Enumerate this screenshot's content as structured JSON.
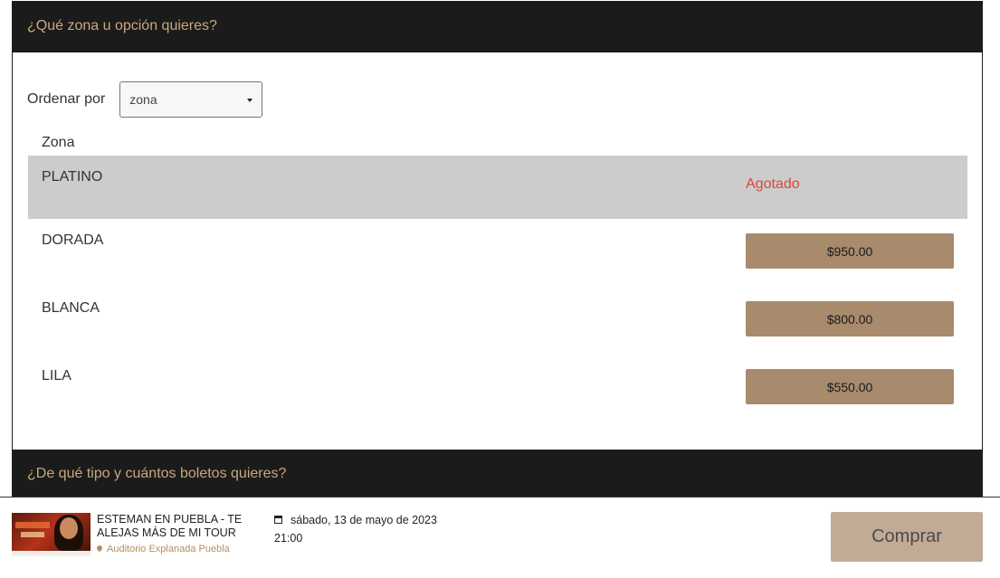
{
  "zone_section": {
    "title": "¿Qué zona u opción quieres?",
    "sort_label": "Ordenar por",
    "sort_selected": "zona",
    "column_header": "Zona",
    "zones": [
      {
        "name": "PLATINO",
        "status": "Agotado",
        "price": null
      },
      {
        "name": "DORADA",
        "status": null,
        "price": "$950.00"
      },
      {
        "name": "BLANCA",
        "status": null,
        "price": "$800.00"
      },
      {
        "name": "LILA",
        "status": null,
        "price": "$550.00"
      }
    ]
  },
  "tickets_section": {
    "title": "¿De qué tipo y cuántos boletos quieres?"
  },
  "event": {
    "title": "ESTEMAN EN PUEBLA - TE ALEJAS MÁS DE MI TOUR",
    "venue": "Auditorio Explanada Puebla",
    "date": "sábado, 13 de mayo de 2023",
    "time": "21:00",
    "buy_label": "Comprar"
  },
  "colors": {
    "header_bg": "#1b1b1b",
    "header_text": "#c9a77f",
    "price_button": "#a88a6c",
    "soldout_text": "#e0453a",
    "buy_button": "#c1ab96"
  }
}
